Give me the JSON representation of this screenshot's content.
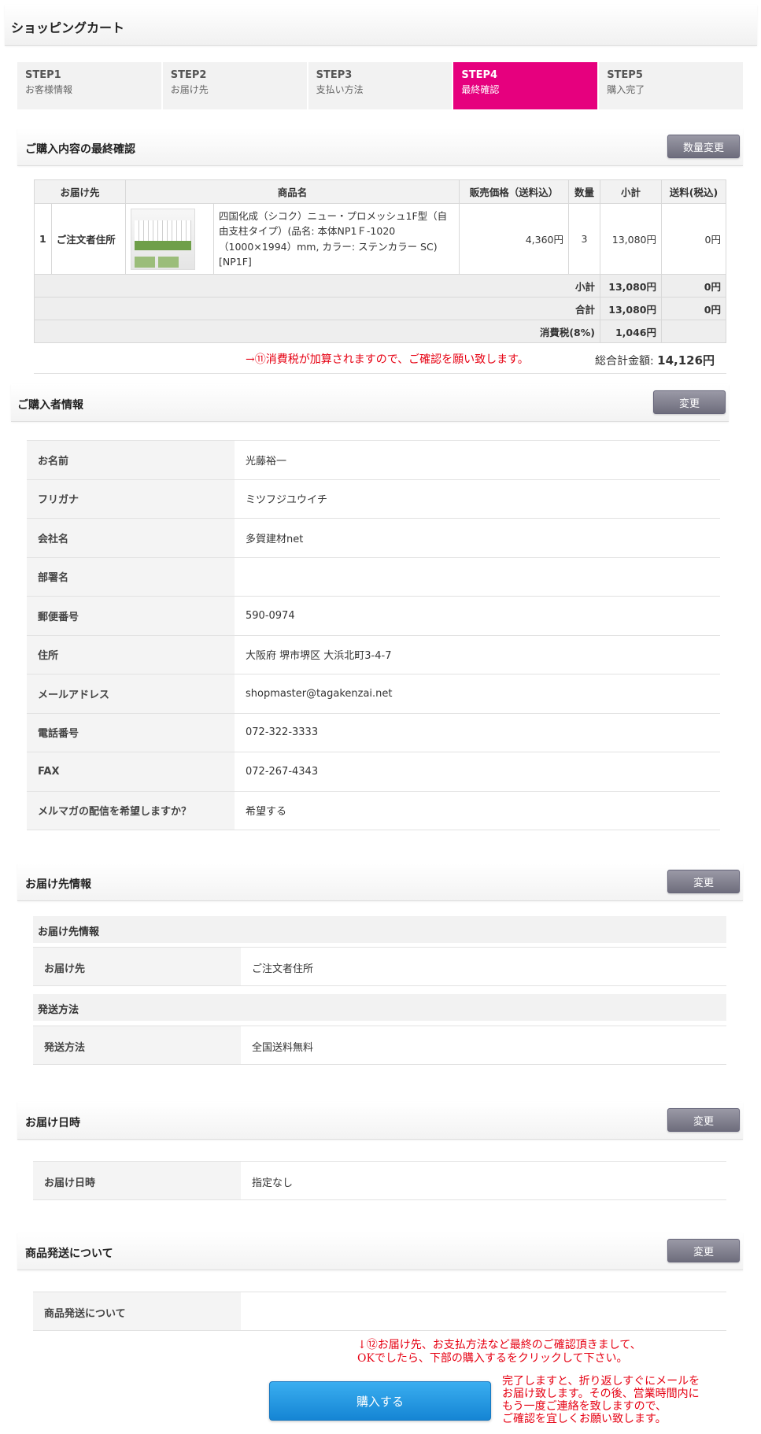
{
  "header": {
    "title": "ショッピングカート"
  },
  "steps": [
    {
      "num": "STEP1",
      "label": "お客様情報"
    },
    {
      "num": "STEP2",
      "label": "お届け先"
    },
    {
      "num": "STEP3",
      "label": "支払い方法"
    },
    {
      "num": "STEP4",
      "label": "最終確認"
    },
    {
      "num": "STEP5",
      "label": "購入完了"
    }
  ],
  "active_step": "STEP4",
  "order": {
    "title": "ご購入内容の最終確認",
    "change_button": "数量変更",
    "columns": [
      "お届け先",
      "商品名",
      "販売価格（送料込）",
      "数量",
      "小計",
      "送料(税込)"
    ],
    "item": {
      "index": "1",
      "destination": "ご注文者住所",
      "product_name": "四国化成（シコク）ニュー・プロメッシュ1F型（自由支柱タイプ）(品名: 本体NP1Ｆ-1020（1000×1994）mm, カラー: ステンカラー SC) [NP1F]",
      "price": "4,360円",
      "qty": "3",
      "subtotal": "13,080円",
      "shipping": "0円"
    },
    "rows": {
      "subtotal_label": "小計",
      "subtotal_value": "13,080円",
      "subtotal_ship": "0円",
      "total_label": "合計",
      "total_value": "13,080円",
      "total_ship": "0円",
      "tax_label": "消費税(8%)",
      "tax_value": "1,046円"
    },
    "tax_notice": "→⑪消費税が加算されますので、ご確認を願い致します。",
    "grand_label": "総合計金額:",
    "grand_value": "14,126円"
  },
  "buyer": {
    "title": "ご購入者情報",
    "change_button": "変更",
    "rows": [
      {
        "k": "お名前",
        "v": "光藤裕一"
      },
      {
        "k": "フリガナ",
        "v": "ミツフジユウイチ"
      },
      {
        "k": "会社名",
        "v": "多賀建材net"
      },
      {
        "k": "部署名",
        "v": ""
      },
      {
        "k": "郵便番号",
        "v": "590-0974"
      },
      {
        "k": "住所",
        "v": "大阪府 堺市堺区 大浜北町3-4-7"
      },
      {
        "k": "メールアドレス",
        "v": "shopmaster@tagakenzai.net"
      },
      {
        "k": "電話番号",
        "v": "072-322-3333"
      },
      {
        "k": "FAX",
        "v": "072-267-4343"
      },
      {
        "k": "メルマガの配信を希望しますか？",
        "v": "希望する"
      }
    ]
  },
  "delivery": {
    "title": "お届け先情報",
    "change_button": "変更",
    "sub1": "お届け先情報",
    "dest_k": "お届け先",
    "dest_v": "ご注文者住所",
    "sub2": "発送方法",
    "method_k": "発送方法",
    "method_v": "全国送料無料"
  },
  "datetime": {
    "title": "お届け日時",
    "change_button": "変更",
    "k": "お届け日時",
    "v": "指定なし"
  },
  "shipping_note": {
    "title": "商品発送について",
    "change_button": "変更",
    "k": "商品発送について",
    "v": ""
  },
  "final_notice": {
    "line1": "↓⑫お届け先、お支払方法など最終のご確認頂きまして、",
    "line2": "OKでしたら、下部の購入するをクリックして下さい。",
    "side1": "完了しますと、折り返しすぐにメールを",
    "side2": "お届け致します。その後、営業時間内に",
    "side3": "もう一度ご連絡を致しますので、",
    "side4": "ご確認を宜しくお願い致します。"
  },
  "purchase_button": "購入する"
}
